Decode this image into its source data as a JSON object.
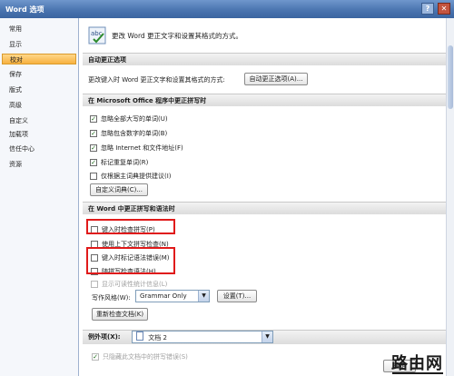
{
  "window": {
    "title": "Word 选项",
    "help_glyph": "?",
    "close_glyph": "✕"
  },
  "sidebar": {
    "items": [
      {
        "label": "常用"
      },
      {
        "label": "显示"
      },
      {
        "label": "校对",
        "selected": true
      },
      {
        "label": "保存"
      },
      {
        "label": "版式"
      },
      {
        "label": "高级"
      },
      {
        "label": "自定义"
      },
      {
        "label": "加载项"
      },
      {
        "label": "信任中心"
      },
      {
        "label": "资源"
      }
    ]
  },
  "header": {
    "text": "更改 Word 更正文字和设置其格式的方式。",
    "icon": "abc-check-icon"
  },
  "autocorrect": {
    "section_title": "自动更正选项",
    "desc": "更改键入时 Word 更正文字和设置其格式的方式:",
    "button_label": "自动更正选项(A)..."
  },
  "office_spelling": {
    "section_title": "在 Microsoft Office 程序中更正拼写时",
    "options": [
      {
        "label": "忽略全部大写的单词(U)",
        "checked": true
      },
      {
        "label": "忽略包含数字的单词(B)",
        "checked": true
      },
      {
        "label": "忽略 Internet 和文件地址(F)",
        "checked": true
      },
      {
        "label": "标记重复单词(R)",
        "checked": true
      },
      {
        "label": "仅根据主词典提供建议(I)",
        "checked": false
      }
    ],
    "dict_button": "自定义词典(C)..."
  },
  "word_spelling": {
    "section_title": "在 Word 中更正拼写和语法时",
    "options": [
      {
        "label": "键入时检查拼写(P)",
        "checked": false
      },
      {
        "label": "使用上下文拼写检查(N)",
        "checked": false
      },
      {
        "label": "键入时标记语法错误(M)",
        "checked": false
      },
      {
        "label": "随拼写检查语法(H)",
        "checked": false
      },
      {
        "label": "显示可读性统计信息(L)",
        "checked": false
      }
    ],
    "writing_style_label": "写作风格(W):",
    "writing_style_value": "Grammar Only",
    "settings_button": "设置(T)...",
    "recheck_button": "重新检查文档(K)"
  },
  "exceptions": {
    "label": "例外项(X):",
    "value": "文档 2",
    "hide_spelling": "只隐藏此文档中的拼写错误(S)"
  },
  "footer": {
    "ok_label": "确定",
    "watermark": "路由网"
  }
}
